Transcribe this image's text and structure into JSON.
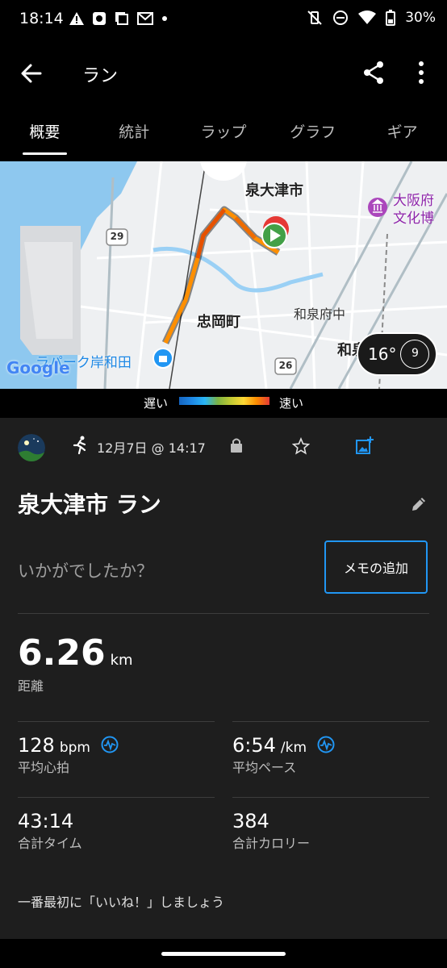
{
  "status": {
    "time": "18:14",
    "battery": "30%"
  },
  "appbar": {
    "title": "ラン"
  },
  "tabs": [
    "概要",
    "統計",
    "ラップ",
    "グラフ",
    "ギア"
  ],
  "map": {
    "labels": {
      "city": "泉大津市",
      "museum": "大阪府\n文化博",
      "tadaoka": "忠岡町",
      "izumi_fuchu": "和泉府中",
      "izumi_cut": "和泉",
      "lapark": "ラパーク岸和田",
      "google": "Google",
      "route29": "29",
      "route26": "26"
    },
    "weather": {
      "temp": "16°",
      "wind": "9"
    }
  },
  "legend": {
    "slow": "遅い",
    "fast": "速い"
  },
  "activity": {
    "date": "12月7日 @ 14:17",
    "title": "泉大津市 ラン",
    "question": "いかがでしたか？",
    "memo_button": "メモの追加",
    "distance": {
      "value": "6.26",
      "unit": "km",
      "label": "距離"
    },
    "heart_rate": {
      "value": "128",
      "unit": "bpm",
      "label": "平均心拍"
    },
    "pace": {
      "value": "6:54",
      "unit": "/km",
      "label": "平均ペース"
    },
    "time": {
      "value": "43:14",
      "label": "合計タイム"
    },
    "calories": {
      "value": "384",
      "label": "合計カロリー"
    },
    "like_prompt": "一番最初に「いいね！」しましょう"
  },
  "colors": {
    "accent": "#2196f3",
    "route": "#ff8f00",
    "background": "#1e1e1e"
  }
}
